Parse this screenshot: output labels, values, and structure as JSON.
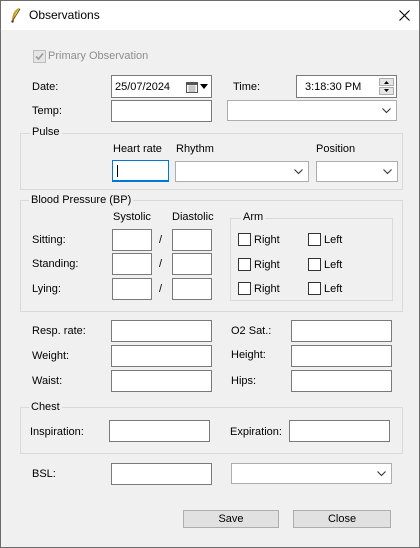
{
  "window": {
    "title": "Observations",
    "app_icon": "app-feather-icon",
    "close_icon": "close-icon"
  },
  "primary": {
    "label": "Primary Observation",
    "checked": true,
    "enabled": false
  },
  "date": {
    "label": "Date:",
    "value": "25/07/2024"
  },
  "time": {
    "label": "Time:",
    "value": "3:18:30 PM"
  },
  "temp": {
    "label": "Temp:",
    "value": "",
    "unit_value": ""
  },
  "pulse": {
    "group_label": "Pulse",
    "heart_rate_label": "Heart rate",
    "heart_rate_value": "",
    "rhythm_label": "Rhythm",
    "rhythm_value": "",
    "position_label": "Position",
    "position_value": ""
  },
  "bp": {
    "group_label": "Blood Pressure (BP)",
    "systolic_label": "Systolic",
    "diastolic_label": "Diastolic",
    "separator": "/",
    "rows": [
      {
        "label": "Sitting:",
        "systolic": "",
        "diastolic": ""
      },
      {
        "label": "Standing:",
        "systolic": "",
        "diastolic": ""
      },
      {
        "label": "Lying:",
        "systolic": "",
        "diastolic": ""
      }
    ],
    "arm": {
      "group_label": "Arm",
      "right_label": "Right",
      "left_label": "Left"
    }
  },
  "resp": {
    "label": "Resp. rate:",
    "value": ""
  },
  "o2": {
    "label": "O2 Sat.:",
    "value": ""
  },
  "weight": {
    "label": "Weight:",
    "value": ""
  },
  "height": {
    "label": "Height:",
    "value": ""
  },
  "waist": {
    "label": "Waist:",
    "value": ""
  },
  "hips": {
    "label": "Hips:",
    "value": ""
  },
  "chest": {
    "group_label": "Chest",
    "inspiration_label": "Inspiration:",
    "inspiration_value": "",
    "expiration_label": "Expiration:",
    "expiration_value": ""
  },
  "bsl": {
    "label": "BSL:",
    "value": "",
    "unit_value": ""
  },
  "buttons": {
    "save": "Save",
    "close": "Close"
  }
}
